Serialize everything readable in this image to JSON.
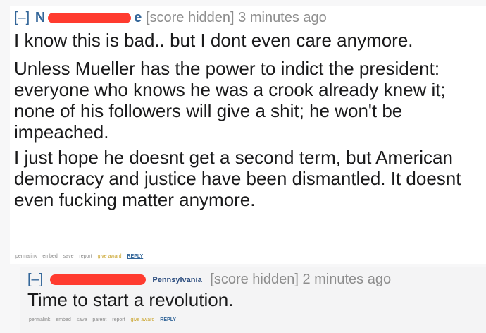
{
  "comment1": {
    "expand": "[–]",
    "author_initial": "N",
    "author_tail": "e",
    "score": "[score hidden]",
    "time": "3 minutes ago",
    "paragraphs": [
      "I know this is bad.. but I dont even care anymore.",
      "Unless Mueller has the power to indict the president: everyone who knows he was a crook already knew it; none of his followers will give a shit; he won't be impeached.",
      "I just hope he doesnt get a second term, but American democracy and justice have been dismantled. It doesnt even fucking matter anymore."
    ],
    "buttons": {
      "permalink": "permalink",
      "embed": "embed",
      "save": "save",
      "report": "report",
      "give_award": "give award",
      "reply": "REPLY"
    }
  },
  "comment2": {
    "expand": "[–]",
    "flair": "Pennsylvania",
    "score": "[score hidden]",
    "time": "2 minutes ago",
    "paragraphs": [
      "Time to start a revolution."
    ],
    "buttons": {
      "permalink": "permalink",
      "embed": "embed",
      "save": "save",
      "parent": "parent",
      "report": "report",
      "give_award": "give award",
      "reply": "REPLY"
    }
  },
  "colors": {
    "redaction": "#ff3b2f",
    "link_blue": "#336699",
    "award_gold": "#c9a32a"
  }
}
